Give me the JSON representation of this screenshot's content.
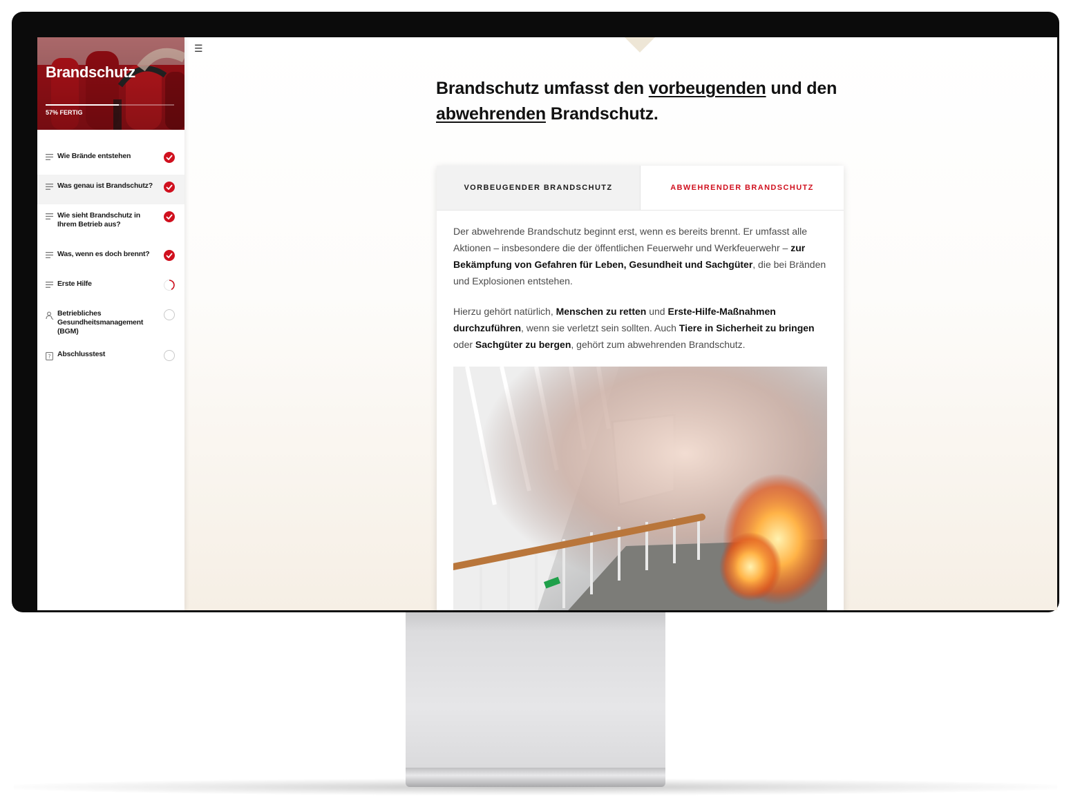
{
  "sidebar": {
    "title": "Brandschutz",
    "progress_percent": 57,
    "progress_label": "57% FERTIG",
    "items": [
      {
        "label": "Wie Brände entstehen",
        "icon": "lines-icon",
        "status": "done"
      },
      {
        "label": "Was genau ist Brandschutz?",
        "icon": "lines-icon",
        "status": "done"
      },
      {
        "label": "Wie sieht Brandschutz in Ihrem Betrieb aus?",
        "icon": "lines-icon",
        "status": "done"
      },
      {
        "label": "Was, wenn es doch brennt?",
        "icon": "lines-icon",
        "status": "done"
      },
      {
        "label": "Erste Hilfe",
        "icon": "lines-icon",
        "status": "in-progress"
      },
      {
        "label": "Betriebliches Gesundheitsmanagement (BGM)",
        "icon": "person-icon",
        "status": "not-started"
      },
      {
        "label": "Abschlusstest",
        "icon": "quiz-icon",
        "status": "not-started"
      }
    ]
  },
  "main": {
    "menu_icon": "hamburger-icon",
    "headline": {
      "part1": "Brandschutz umfasst den ",
      "link1": "vorbeugenden",
      "part2": " und den ",
      "link2": "abwehrenden",
      "part3": " Brandschutz."
    },
    "tabs": [
      {
        "label": "VORBEUGENDER BRANDSCHUTZ",
        "active": false
      },
      {
        "label": "ABWEHRENDER BRANDSCHUTZ",
        "active": true
      }
    ],
    "paragraph1": {
      "t1": "Der abwehrende Brandschutz beginnt erst, wenn es bereits brennt. Er umfasst alle Aktionen – insbesondere die der öffentlichen Feuerwehr und Werkfeuerwehr – ",
      "b1": "zur Bekämpfung von Gefahren für Leben, Gesundheit und Sachgüter",
      "t2": ", die bei Bränden und Explosionen entstehen."
    },
    "paragraph2": {
      "t1": "Hierzu gehört natürlich, ",
      "b1": "Menschen zu retten",
      "t2": " und ",
      "b2": "Erste-Hilfe-Maßnahmen durchzuführen",
      "t3": ", wenn sie verletzt sein sollten. Auch ",
      "b3": "Tiere in Sicherheit zu bringen",
      "t4": " oder ",
      "b4": "Sachgüter zu bergen",
      "t5": ", gehört zum abwehrenden Brandschutz."
    }
  },
  "colors": {
    "accent": "#d0101e",
    "text": "#111111",
    "body_text": "#4a4a4a"
  }
}
